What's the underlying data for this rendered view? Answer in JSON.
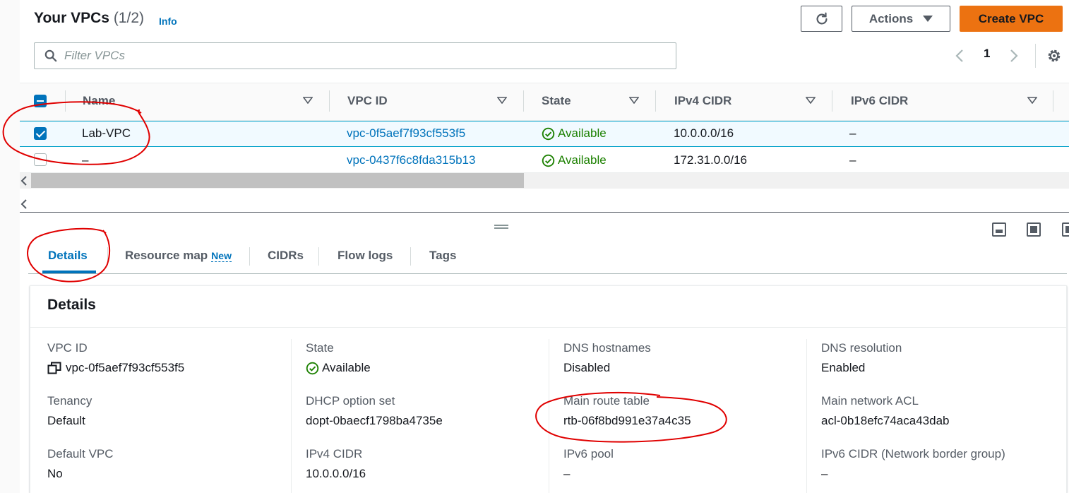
{
  "header": {
    "title": "Your VPCs",
    "count": "(1/2)",
    "info": "Info",
    "actions_label": "Actions",
    "create_label": "Create VPC"
  },
  "filter": {
    "placeholder": "Filter VPCs"
  },
  "pagination": {
    "prev": "‹",
    "page": "1",
    "next": "›"
  },
  "table": {
    "columns": [
      "Name",
      "VPC ID",
      "State",
      "IPv4 CIDR",
      "IPv6 CIDR"
    ],
    "rows": [
      {
        "name": "Lab-VPC",
        "vpc_id": "vpc-0f5aef7f93cf553f5",
        "state": "Available",
        "ipv4": "10.0.0.0/16",
        "ipv6": "–",
        "selected": true
      },
      {
        "name": "–",
        "vpc_id": "vpc-0437f6c8fda315b13",
        "state": "Available",
        "ipv4": "172.31.0.0/16",
        "ipv6": "–",
        "selected": false
      }
    ]
  },
  "tabs": [
    {
      "label": "Details",
      "active": true
    },
    {
      "label": "Resource map",
      "badge": "New"
    },
    {
      "label": "CIDRs"
    },
    {
      "label": "Flow logs"
    },
    {
      "label": "Tags"
    }
  ],
  "details": {
    "title": "Details",
    "fields": {
      "vpc_id": {
        "label": "VPC ID",
        "value": "vpc-0f5aef7f93cf553f5"
      },
      "state": {
        "label": "State",
        "value": "Available"
      },
      "dns_hostnames": {
        "label": "DNS hostnames",
        "value": "Disabled"
      },
      "dns_resolution": {
        "label": "DNS resolution",
        "value": "Enabled"
      },
      "tenancy": {
        "label": "Tenancy",
        "value": "Default"
      },
      "dhcp": {
        "label": "DHCP option set",
        "value": "dopt-0baecf1798ba4735e"
      },
      "main_route_table": {
        "label": "Main route table",
        "value": "rtb-06f8bd991e37a4c35"
      },
      "main_acl": {
        "label": "Main network ACL",
        "value": "acl-0b18efc74aca43dab"
      },
      "default_vpc": {
        "label": "Default VPC",
        "value": "No"
      },
      "ipv4_cidr": {
        "label": "IPv4 CIDR",
        "value": "10.0.0.0/16"
      },
      "ipv6_pool": {
        "label": "IPv6 pool",
        "value": "–"
      },
      "ipv6_cidr_nbg": {
        "label": "IPv6 CIDR (Network border group)",
        "value": "–"
      }
    }
  },
  "colors": {
    "link": "#0073bb",
    "success": "#1d8102",
    "primary_button": "#ec7211",
    "annotation": "#e00000"
  },
  "icons": [
    "refresh-icon",
    "caret-down-icon",
    "search-icon",
    "chevron-left-icon",
    "chevron-right-icon",
    "gear-icon",
    "sort-icon",
    "check-circle-icon",
    "copy-icon",
    "panel-bottom-icon",
    "panel-full-icon",
    "panel-side-icon"
  ]
}
